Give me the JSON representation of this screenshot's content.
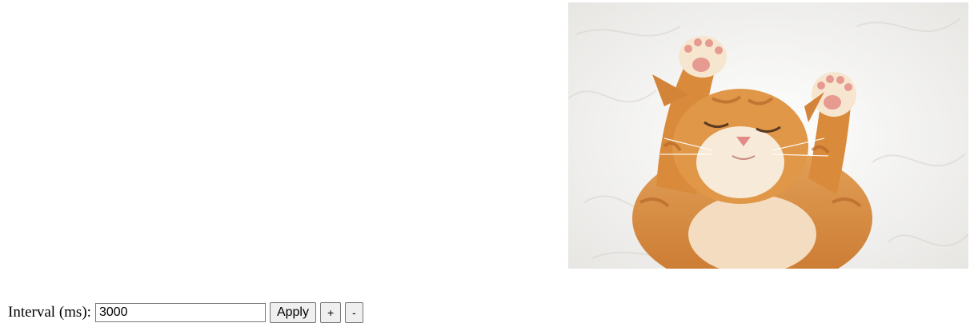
{
  "image": {
    "subject": "sleeping orange kitten on white fur",
    "colors": {
      "background_fur": "#f2f1ef",
      "kitten_orange": "#d98a3a",
      "kitten_light": "#f6e6cf",
      "paw_pink": "#e79a8f",
      "nose_pink": "#e28a86"
    }
  },
  "controls": {
    "interval_label": "Interval (ms):",
    "interval_value": "3000",
    "apply_label": "Apply",
    "increase_label": "+",
    "decrease_label": "-"
  }
}
